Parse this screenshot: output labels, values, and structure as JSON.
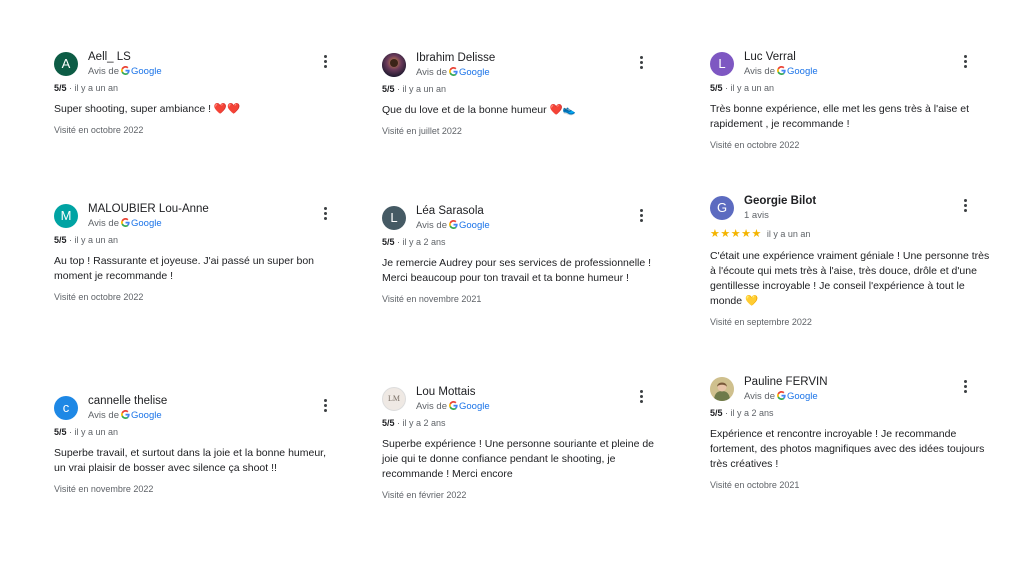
{
  "colors": {
    "google_blue": "#1a73e8",
    "star": "#f4b400",
    "muted": "#5f6368"
  },
  "reviews": [
    {
      "name": "Aell_ LS",
      "avatar_letter": "A",
      "avatar_color": "#0d5c45",
      "source_prefix": "Avis de",
      "source": "Google",
      "rating": "5/5",
      "time": "· il y a un an",
      "text": "Super shooting, super ambiance ! ❤️❤️",
      "visited": "Visité en octobre 2022"
    },
    {
      "name": "Ibrahim Delisse",
      "avatar_icon": "photo-avatar-icon",
      "source_prefix": "Avis de",
      "source": "Google",
      "rating": "5/5",
      "time": "· il y a un an",
      "text": "Que du love et de la bonne humeur ❤️👟",
      "visited": "Visité en juillet 2022"
    },
    {
      "name": "Luc Verral",
      "avatar_letter": "L",
      "avatar_color": "#7e57c2",
      "source_prefix": "Avis de",
      "source": "Google",
      "rating": "5/5",
      "time": "· il y a un an",
      "text": "Très bonne expérience, elle met les gens très à l'aise et rapidement , je recommande !",
      "visited": "Visité en octobre 2022"
    },
    {
      "name": "MALOUBIER Lou-Anne",
      "avatar_letter": "M",
      "avatar_color": "#00a3a3",
      "source_prefix": "Avis de",
      "source": "Google",
      "rating": "5/5",
      "time": "· il y a un an",
      "text": "Au top ! Rassurante et joyeuse. J'ai passé un super bon moment je recommande !",
      "visited": "Visité en octobre 2022"
    },
    {
      "name": "Léa Sarasola",
      "avatar_letter": "L",
      "avatar_color": "#455a64",
      "source_prefix": "Avis de",
      "source": "Google",
      "rating": "5/5",
      "time": "· il y a 2 ans",
      "text": "Je remercie Audrey pour ses services de professionnelle ! Merci beaucoup pour ton travail et ta bonne humeur !",
      "visited": "Visité en novembre 2021"
    },
    {
      "name": "Georgie Bilot",
      "avatar_letter": "G",
      "avatar_color": "#5c6bc0",
      "subline": "1 avis",
      "stars": "★★★★★",
      "time": "il y a un an",
      "text": "C'était une expérience vraiment géniale ! Une personne très à l'écoute qui mets très à l'aise, très douce, drôle et d'une gentillesse incroyable ! Je conseil l'expérience à tout le monde 💛",
      "visited": "Visité en septembre 2022"
    },
    {
      "name": "cannelle thelise",
      "avatar_letter": "c",
      "avatar_color": "#1e88e5",
      "source_prefix": "Avis de",
      "source": "Google",
      "rating": "5/5",
      "time": "· il y a un an",
      "text": "Superbe travail, et surtout dans la joie et la bonne humeur, un vrai plaisir de bosser avec silence ça shoot !!",
      "visited": "Visité en novembre 2022"
    },
    {
      "name": "Lou Mottais",
      "avatar_letter": "LM",
      "avatar_color": "#efe9e4",
      "source_prefix": "Avis de",
      "source": "Google",
      "rating": "5/5",
      "time": "· il y a 2 ans",
      "text": "Superbe expérience ! Une personne souriante et pleine de joie qui te donne confiance pendant le shooting, je recommande ! Merci encore",
      "visited": "Visité en février 2022"
    },
    {
      "name": "Pauline FERVIN",
      "avatar_icon": "photo-avatar-icon",
      "source_prefix": "Avis de",
      "source": "Google",
      "rating": "5/5",
      "time": "· il y a 2 ans",
      "text": "Expérience et rencontre incroyable ! Je recommande fortement, des photos magnifiques avec des idées toujours très créatives !",
      "visited": "Visité en octobre 2021"
    }
  ]
}
